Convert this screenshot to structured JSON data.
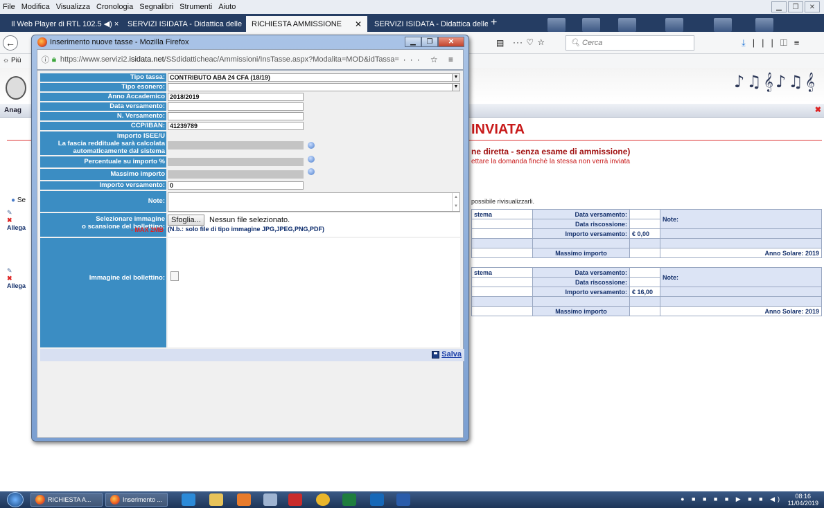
{
  "menubar": [
    "File",
    "Modifica",
    "Visualizza",
    "Cronologia",
    "Segnalibri",
    "Strumenti",
    "Aiuto"
  ],
  "tabs": [
    {
      "label": "Il Web Player di RTL 102.5  ◀) ×"
    },
    {
      "label": "SERVIZI ISIDATA - Didattica delle"
    },
    {
      "label": "RICHIESTA AMMISSIONE"
    },
    {
      "label": "SERVIZI ISIDATA - Didattica delle"
    }
  ],
  "nav": {
    "search_placeholder": "Cerca"
  },
  "bookmarks_label": "☼ Più",
  "page": {
    "anag": "Anag",
    "title": "INVIATA",
    "subtitle1": "ne diretta - senza esame di ammissione)",
    "subtitle2": "ettare la domanda finchè la stessa non verrà inviata",
    "se": "Se",
    "note_vis": "possibile rivisualizzarli.",
    "stema": "stema",
    "allega": "Allega",
    "data_versamento": "Data versamento:",
    "data_riscossione": "Data riscossione:",
    "importo_versamento": "Importo versamento:",
    "importo1": "€ 0,00",
    "importo2": "€ 16,00",
    "note": "Note:",
    "massimo": "Massimo importo",
    "anno_solare": "Anno Solare: 2019"
  },
  "popup": {
    "title": "Inserimento nuove tasse - Mozilla Firefox",
    "url_prefix": "https://www.servizi2.",
    "url_domain": "isidata.net",
    "url_rest": "/SSdidatticheac/Ammissioni/InsTasse.aspx?Modalita=MOD&idTassa=",
    "url_tools": "··· ☆ ≡"
  },
  "form": {
    "tipo_tassa_label": "Tipo tassa:",
    "tipo_tassa_value": "CONTRIBUTO ABA 24 CFA (18/19)",
    "tipo_esonero_label": "Tipo esonero:",
    "anno_label": "Anno Accademico",
    "anno_value": "2018/2019",
    "data_vers_label": "Data versamento:",
    "n_vers_label": "N. Versamento:",
    "ccp_label": "CCP/IBAN:",
    "ccp_value": "41239789",
    "isee_label1": "Importo ISEE/U",
    "isee_label2": "La fascia reddituale sarà calcolata",
    "isee_label3": "automaticamente dal sistema",
    "perc_label": "Percentuale su importo %",
    "max_label": "Massimo importo",
    "importo_label": "Importo versamento:",
    "importo_value": "0",
    "note_label": "Note:",
    "sel_label1": "Selezionare immagine",
    "sel_label2": "o scansione del bollettino:",
    "max_mb": "- MAX 2MB",
    "sfoglia": "Sfoglia...",
    "nofile": "Nessun file selezionato.",
    "nb": "(N.b.: solo file di tipo immagine JPG,JPEG,PNG,PDF)",
    "immagine_label": "Immagine del bollettino:",
    "salva": "Salva"
  },
  "taskbar": {
    "btn1": "RICHIESTA A...",
    "btn2": "Inserimento ...",
    "time": "08:16",
    "date": "11/04/2019"
  }
}
